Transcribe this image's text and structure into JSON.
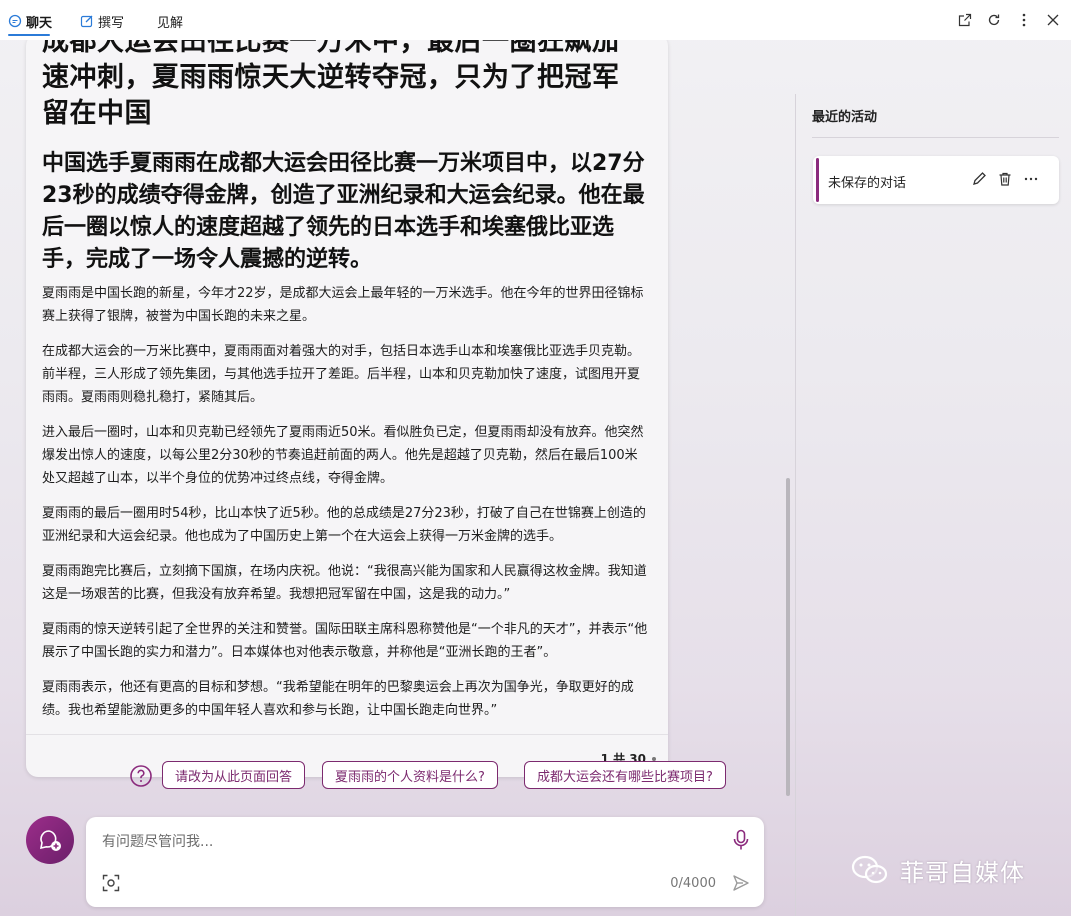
{
  "tabs": [
    {
      "label": "聊天",
      "icon": "chat-icon",
      "active": true
    },
    {
      "label": "撰写",
      "icon": "compose-icon",
      "active": false
    },
    {
      "label": "见解",
      "icon": "",
      "active": false
    }
  ],
  "window_controls": [
    "open-external-icon",
    "refresh-icon",
    "more-icon",
    "close-icon"
  ],
  "article": {
    "title": "成都大运会田径比赛一万米中，最后一圈狂飙加速冲刺，夏雨雨惊天大逆转夺冠，只为了把冠军留在中国",
    "subtitle": "中国选手夏雨雨在成都大运会田径比赛一万米项目中，以27分23秒的成绩夺得金牌，创造了亚洲纪录和大运会纪录。他在最后一圈以惊人的速度超越了领先的日本选手和埃塞俄比亚选手，完成了一场令人震撼的逆转。",
    "paragraphs": [
      "夏雨雨是中国长跑的新星，今年才22岁，是成都大运会上最年轻的一万米选手。他在今年的世界田径锦标赛上获得了银牌，被誉为中国长跑的未来之星。",
      "在成都大运会的一万米比赛中，夏雨雨面对着强大的对手，包括日本选手山本和埃塞俄比亚选手贝克勒。前半程，三人形成了领先集团，与其他选手拉开了差距。后半程，山本和贝克勒加快了速度，试图甩开夏雨雨。夏雨雨则稳扎稳打，紧随其后。",
      "进入最后一圈时，山本和贝克勒已经领先了夏雨雨近50米。看似胜负已定，但夏雨雨却没有放弃。他突然爆发出惊人的速度，以每公里2分30秒的节奏追赶前面的两人。他先是超越了贝克勒，然后在最后100米处又超越了山本，以半个身位的优势冲过终点线，夺得金牌。",
      "夏雨雨的最后一圈用时54秒，比山本快了近5秒。他的总成绩是27分23秒，打破了自己在世锦赛上创造的亚洲纪录和大运会纪录。他也成为了中国历史上第一个在大运会上获得一万米金牌的选手。",
      "夏雨雨跑完比赛后，立刻摘下国旗，在场内庆祝。他说：“我很高兴能为国家和人民赢得这枚金牌。我知道这是一场艰苦的比赛，但我没有放弃希望。我想把冠军留在中国，这是我的动力。”",
      "夏雨雨的惊天逆转引起了全世界的关注和赞誉。国际田联主席科恩称赞他是“一个非凡的天才”，并表示“他展示了中国长跑的实力和潜力”。日本媒体也对他表示敬意，并称他是“亚洲长跑的王者”。",
      "夏雨雨表示，他还有更高的目标和梦想。“我希望能在明年的巴黎奥运会上再次为国争光，争取更好的成绩。我也希望能激励更多的中国年轻人喜欢和参与长跑，让中国长跑走向世界。”"
    ],
    "counter": "1 共 30"
  },
  "suggestions": [
    "请改为从此页面回答",
    "夏雨雨的个人资料是什么?",
    "成都大运会还有哪些比赛项目?"
  ],
  "composer": {
    "placeholder": "有问题尽管问我...",
    "char_count": "0/4000"
  },
  "sidebar": {
    "title": "最近的活动",
    "items": [
      {
        "label": "未保存的对话"
      }
    ]
  },
  "watermark": "菲哥自媒体",
  "colors": {
    "accent": "#8b2b7d",
    "tab_underline": "#2b7bd8"
  }
}
